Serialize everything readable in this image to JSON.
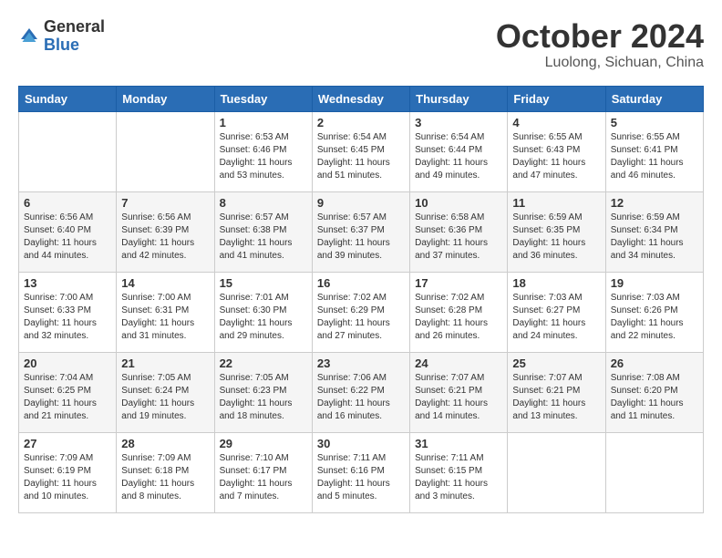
{
  "header": {
    "logo_general": "General",
    "logo_blue": "Blue",
    "month": "October 2024",
    "location": "Luolong, Sichuan, China"
  },
  "weekdays": [
    "Sunday",
    "Monday",
    "Tuesday",
    "Wednesday",
    "Thursday",
    "Friday",
    "Saturday"
  ],
  "weeks": [
    [
      {
        "day": "",
        "info": ""
      },
      {
        "day": "",
        "info": ""
      },
      {
        "day": "1",
        "info": "Sunrise: 6:53 AM\nSunset: 6:46 PM\nDaylight: 11 hours\nand 53 minutes."
      },
      {
        "day": "2",
        "info": "Sunrise: 6:54 AM\nSunset: 6:45 PM\nDaylight: 11 hours\nand 51 minutes."
      },
      {
        "day": "3",
        "info": "Sunrise: 6:54 AM\nSunset: 6:44 PM\nDaylight: 11 hours\nand 49 minutes."
      },
      {
        "day": "4",
        "info": "Sunrise: 6:55 AM\nSunset: 6:43 PM\nDaylight: 11 hours\nand 47 minutes."
      },
      {
        "day": "5",
        "info": "Sunrise: 6:55 AM\nSunset: 6:41 PM\nDaylight: 11 hours\nand 46 minutes."
      }
    ],
    [
      {
        "day": "6",
        "info": "Sunrise: 6:56 AM\nSunset: 6:40 PM\nDaylight: 11 hours\nand 44 minutes."
      },
      {
        "day": "7",
        "info": "Sunrise: 6:56 AM\nSunset: 6:39 PM\nDaylight: 11 hours\nand 42 minutes."
      },
      {
        "day": "8",
        "info": "Sunrise: 6:57 AM\nSunset: 6:38 PM\nDaylight: 11 hours\nand 41 minutes."
      },
      {
        "day": "9",
        "info": "Sunrise: 6:57 AM\nSunset: 6:37 PM\nDaylight: 11 hours\nand 39 minutes."
      },
      {
        "day": "10",
        "info": "Sunrise: 6:58 AM\nSunset: 6:36 PM\nDaylight: 11 hours\nand 37 minutes."
      },
      {
        "day": "11",
        "info": "Sunrise: 6:59 AM\nSunset: 6:35 PM\nDaylight: 11 hours\nand 36 minutes."
      },
      {
        "day": "12",
        "info": "Sunrise: 6:59 AM\nSunset: 6:34 PM\nDaylight: 11 hours\nand 34 minutes."
      }
    ],
    [
      {
        "day": "13",
        "info": "Sunrise: 7:00 AM\nSunset: 6:33 PM\nDaylight: 11 hours\nand 32 minutes."
      },
      {
        "day": "14",
        "info": "Sunrise: 7:00 AM\nSunset: 6:31 PM\nDaylight: 11 hours\nand 31 minutes."
      },
      {
        "day": "15",
        "info": "Sunrise: 7:01 AM\nSunset: 6:30 PM\nDaylight: 11 hours\nand 29 minutes."
      },
      {
        "day": "16",
        "info": "Sunrise: 7:02 AM\nSunset: 6:29 PM\nDaylight: 11 hours\nand 27 minutes."
      },
      {
        "day": "17",
        "info": "Sunrise: 7:02 AM\nSunset: 6:28 PM\nDaylight: 11 hours\nand 26 minutes."
      },
      {
        "day": "18",
        "info": "Sunrise: 7:03 AM\nSunset: 6:27 PM\nDaylight: 11 hours\nand 24 minutes."
      },
      {
        "day": "19",
        "info": "Sunrise: 7:03 AM\nSunset: 6:26 PM\nDaylight: 11 hours\nand 22 minutes."
      }
    ],
    [
      {
        "day": "20",
        "info": "Sunrise: 7:04 AM\nSunset: 6:25 PM\nDaylight: 11 hours\nand 21 minutes."
      },
      {
        "day": "21",
        "info": "Sunrise: 7:05 AM\nSunset: 6:24 PM\nDaylight: 11 hours\nand 19 minutes."
      },
      {
        "day": "22",
        "info": "Sunrise: 7:05 AM\nSunset: 6:23 PM\nDaylight: 11 hours\nand 18 minutes."
      },
      {
        "day": "23",
        "info": "Sunrise: 7:06 AM\nSunset: 6:22 PM\nDaylight: 11 hours\nand 16 minutes."
      },
      {
        "day": "24",
        "info": "Sunrise: 7:07 AM\nSunset: 6:21 PM\nDaylight: 11 hours\nand 14 minutes."
      },
      {
        "day": "25",
        "info": "Sunrise: 7:07 AM\nSunset: 6:21 PM\nDaylight: 11 hours\nand 13 minutes."
      },
      {
        "day": "26",
        "info": "Sunrise: 7:08 AM\nSunset: 6:20 PM\nDaylight: 11 hours\nand 11 minutes."
      }
    ],
    [
      {
        "day": "27",
        "info": "Sunrise: 7:09 AM\nSunset: 6:19 PM\nDaylight: 11 hours\nand 10 minutes."
      },
      {
        "day": "28",
        "info": "Sunrise: 7:09 AM\nSunset: 6:18 PM\nDaylight: 11 hours\nand 8 minutes."
      },
      {
        "day": "29",
        "info": "Sunrise: 7:10 AM\nSunset: 6:17 PM\nDaylight: 11 hours\nand 7 minutes."
      },
      {
        "day": "30",
        "info": "Sunrise: 7:11 AM\nSunset: 6:16 PM\nDaylight: 11 hours\nand 5 minutes."
      },
      {
        "day": "31",
        "info": "Sunrise: 7:11 AM\nSunset: 6:15 PM\nDaylight: 11 hours\nand 3 minutes."
      },
      {
        "day": "",
        "info": ""
      },
      {
        "day": "",
        "info": ""
      }
    ]
  ]
}
